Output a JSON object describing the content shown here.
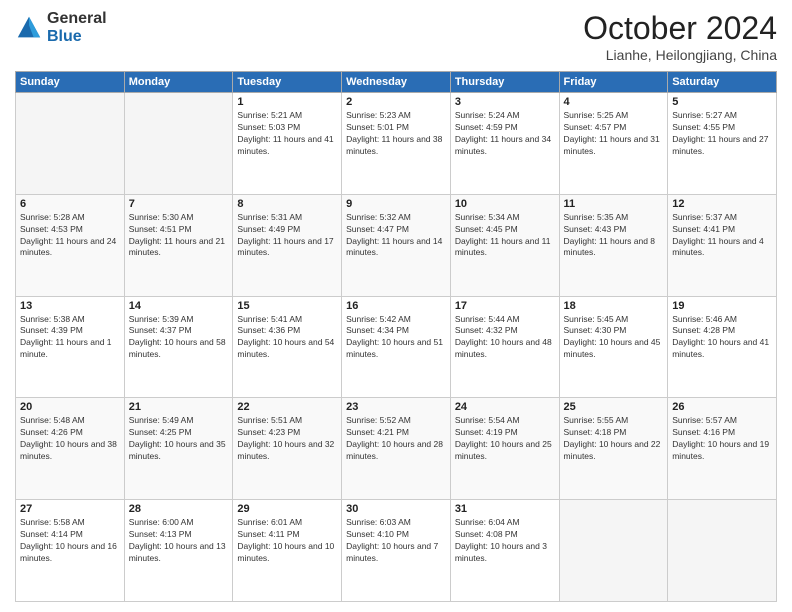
{
  "header": {
    "logo_line1": "General",
    "logo_line2": "Blue",
    "month": "October 2024",
    "location": "Lianhe, Heilongjiang, China"
  },
  "weekdays": [
    "Sunday",
    "Monday",
    "Tuesday",
    "Wednesday",
    "Thursday",
    "Friday",
    "Saturday"
  ],
  "weeks": [
    [
      {
        "day": "",
        "info": ""
      },
      {
        "day": "",
        "info": ""
      },
      {
        "day": "1",
        "info": "Sunrise: 5:21 AM\nSunset: 5:03 PM\nDaylight: 11 hours and 41 minutes."
      },
      {
        "day": "2",
        "info": "Sunrise: 5:23 AM\nSunset: 5:01 PM\nDaylight: 11 hours and 38 minutes."
      },
      {
        "day": "3",
        "info": "Sunrise: 5:24 AM\nSunset: 4:59 PM\nDaylight: 11 hours and 34 minutes."
      },
      {
        "day": "4",
        "info": "Sunrise: 5:25 AM\nSunset: 4:57 PM\nDaylight: 11 hours and 31 minutes."
      },
      {
        "day": "5",
        "info": "Sunrise: 5:27 AM\nSunset: 4:55 PM\nDaylight: 11 hours and 27 minutes."
      }
    ],
    [
      {
        "day": "6",
        "info": "Sunrise: 5:28 AM\nSunset: 4:53 PM\nDaylight: 11 hours and 24 minutes."
      },
      {
        "day": "7",
        "info": "Sunrise: 5:30 AM\nSunset: 4:51 PM\nDaylight: 11 hours and 21 minutes."
      },
      {
        "day": "8",
        "info": "Sunrise: 5:31 AM\nSunset: 4:49 PM\nDaylight: 11 hours and 17 minutes."
      },
      {
        "day": "9",
        "info": "Sunrise: 5:32 AM\nSunset: 4:47 PM\nDaylight: 11 hours and 14 minutes."
      },
      {
        "day": "10",
        "info": "Sunrise: 5:34 AM\nSunset: 4:45 PM\nDaylight: 11 hours and 11 minutes."
      },
      {
        "day": "11",
        "info": "Sunrise: 5:35 AM\nSunset: 4:43 PM\nDaylight: 11 hours and 8 minutes."
      },
      {
        "day": "12",
        "info": "Sunrise: 5:37 AM\nSunset: 4:41 PM\nDaylight: 11 hours and 4 minutes."
      }
    ],
    [
      {
        "day": "13",
        "info": "Sunrise: 5:38 AM\nSunset: 4:39 PM\nDaylight: 11 hours and 1 minute."
      },
      {
        "day": "14",
        "info": "Sunrise: 5:39 AM\nSunset: 4:37 PM\nDaylight: 10 hours and 58 minutes."
      },
      {
        "day": "15",
        "info": "Sunrise: 5:41 AM\nSunset: 4:36 PM\nDaylight: 10 hours and 54 minutes."
      },
      {
        "day": "16",
        "info": "Sunrise: 5:42 AM\nSunset: 4:34 PM\nDaylight: 10 hours and 51 minutes."
      },
      {
        "day": "17",
        "info": "Sunrise: 5:44 AM\nSunset: 4:32 PM\nDaylight: 10 hours and 48 minutes."
      },
      {
        "day": "18",
        "info": "Sunrise: 5:45 AM\nSunset: 4:30 PM\nDaylight: 10 hours and 45 minutes."
      },
      {
        "day": "19",
        "info": "Sunrise: 5:46 AM\nSunset: 4:28 PM\nDaylight: 10 hours and 41 minutes."
      }
    ],
    [
      {
        "day": "20",
        "info": "Sunrise: 5:48 AM\nSunset: 4:26 PM\nDaylight: 10 hours and 38 minutes."
      },
      {
        "day": "21",
        "info": "Sunrise: 5:49 AM\nSunset: 4:25 PM\nDaylight: 10 hours and 35 minutes."
      },
      {
        "day": "22",
        "info": "Sunrise: 5:51 AM\nSunset: 4:23 PM\nDaylight: 10 hours and 32 minutes."
      },
      {
        "day": "23",
        "info": "Sunrise: 5:52 AM\nSunset: 4:21 PM\nDaylight: 10 hours and 28 minutes."
      },
      {
        "day": "24",
        "info": "Sunrise: 5:54 AM\nSunset: 4:19 PM\nDaylight: 10 hours and 25 minutes."
      },
      {
        "day": "25",
        "info": "Sunrise: 5:55 AM\nSunset: 4:18 PM\nDaylight: 10 hours and 22 minutes."
      },
      {
        "day": "26",
        "info": "Sunrise: 5:57 AM\nSunset: 4:16 PM\nDaylight: 10 hours and 19 minutes."
      }
    ],
    [
      {
        "day": "27",
        "info": "Sunrise: 5:58 AM\nSunset: 4:14 PM\nDaylight: 10 hours and 16 minutes."
      },
      {
        "day": "28",
        "info": "Sunrise: 6:00 AM\nSunset: 4:13 PM\nDaylight: 10 hours and 13 minutes."
      },
      {
        "day": "29",
        "info": "Sunrise: 6:01 AM\nSunset: 4:11 PM\nDaylight: 10 hours and 10 minutes."
      },
      {
        "day": "30",
        "info": "Sunrise: 6:03 AM\nSunset: 4:10 PM\nDaylight: 10 hours and 7 minutes."
      },
      {
        "day": "31",
        "info": "Sunrise: 6:04 AM\nSunset: 4:08 PM\nDaylight: 10 hours and 3 minutes."
      },
      {
        "day": "",
        "info": ""
      },
      {
        "day": "",
        "info": ""
      }
    ]
  ]
}
